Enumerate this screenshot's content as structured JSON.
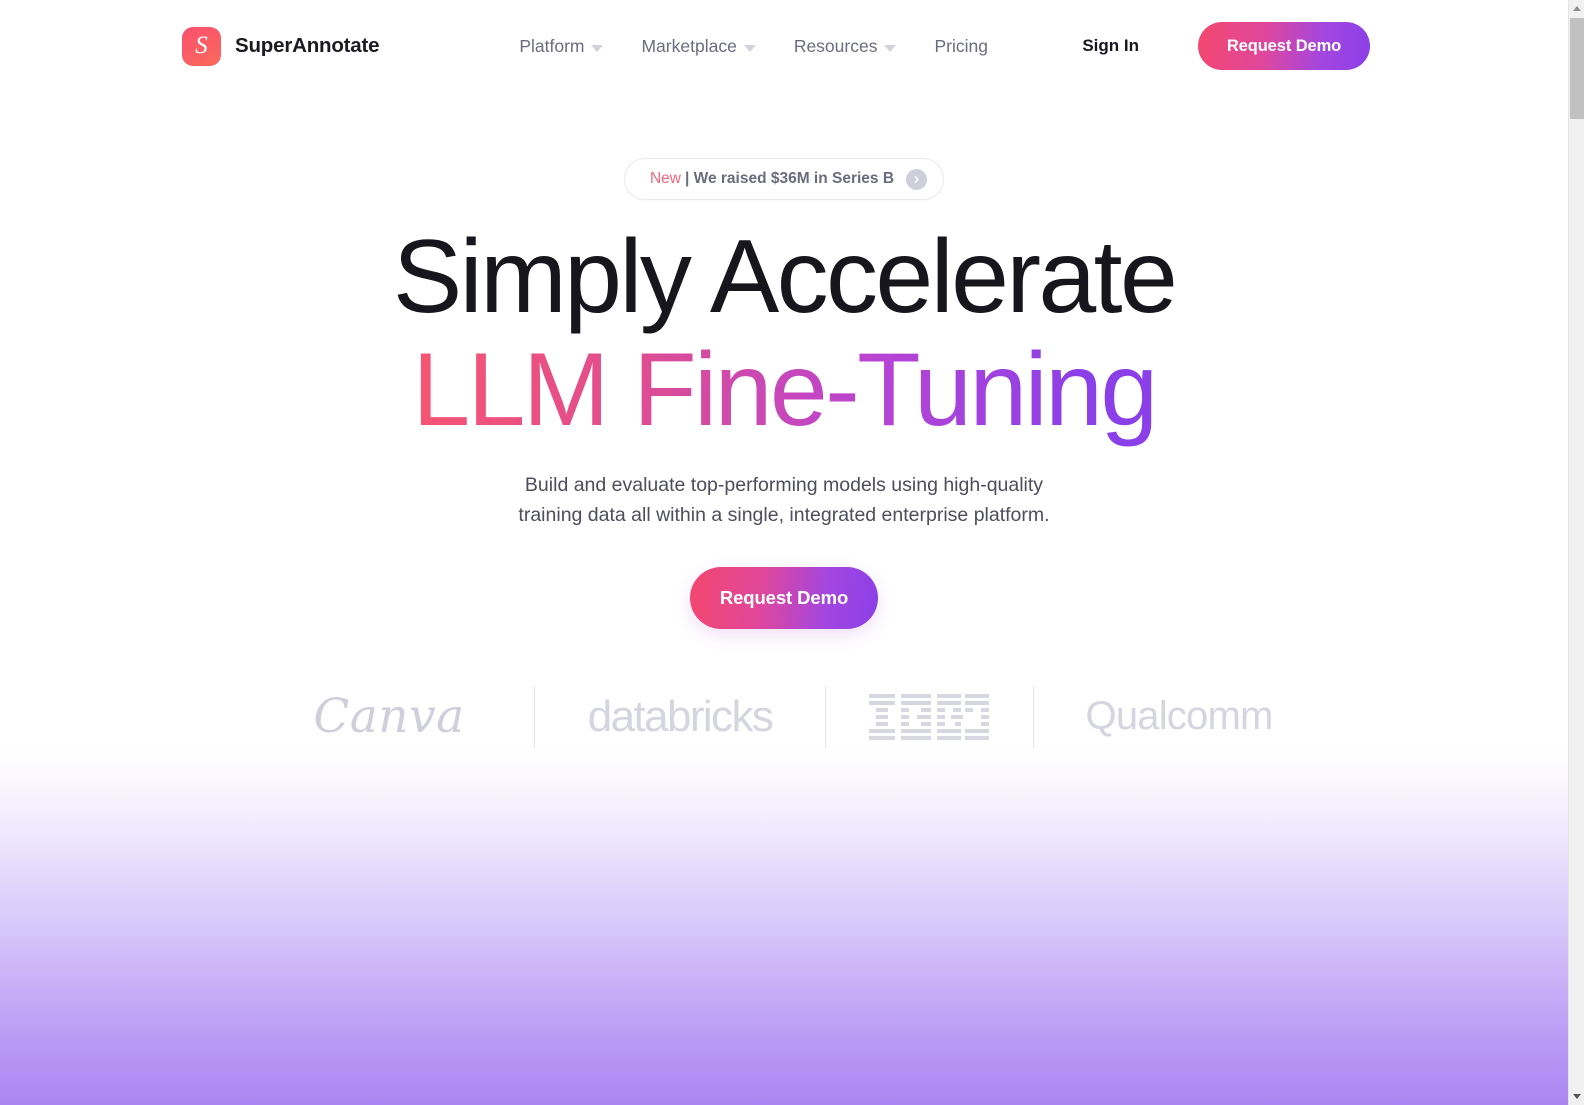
{
  "brand": {
    "mark_letter": "S",
    "name": "SuperAnnotate"
  },
  "nav": {
    "items": [
      {
        "label": "Platform",
        "has_caret": true
      },
      {
        "label": "Marketplace",
        "has_caret": true
      },
      {
        "label": "Resources",
        "has_caret": true
      },
      {
        "label": "Pricing",
        "has_caret": false
      }
    ],
    "sign_in_label": "Sign In",
    "request_demo_label": "Request Demo"
  },
  "hero": {
    "badge": {
      "tag": "New",
      "text": "| We raised $36M in Series B",
      "arrow_icon": "chevron-right-icon"
    },
    "headline_line1": "Simply Accelerate",
    "headline_line2": "LLM Fine-Tuning",
    "subhead_line1": "Build and evaluate top-performing models using high-quality",
    "subhead_line2": "training data all within a single, integrated enterprise platform.",
    "cta_label": "Request Demo"
  },
  "logos": [
    {
      "name": "Canva",
      "type": "wordmark-script"
    },
    {
      "name": "databricks",
      "type": "wordmark"
    },
    {
      "name": "IBM",
      "type": "striped-logo"
    },
    {
      "name": "Qualcomm",
      "type": "wordmark"
    }
  ],
  "colors": {
    "accent_pink": "#F4476E",
    "accent_purple": "#8B3FE8",
    "badge_new": "#F4647F",
    "nav_text": "#6c6c80",
    "heading": "#16161c",
    "body_text": "#4d4d5c",
    "logo_gray": "#d5d5e0",
    "section_purple": "#ab86f2"
  },
  "scrollbar": {
    "up_icon": "triangle-up-icon",
    "down_icon": "triangle-down-icon"
  }
}
